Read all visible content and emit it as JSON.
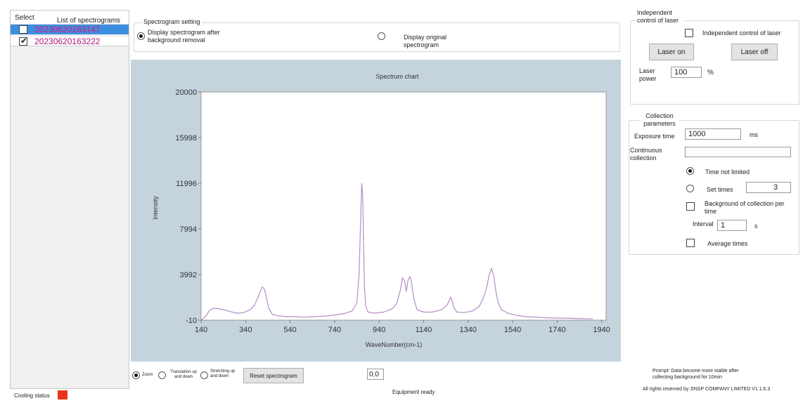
{
  "spectrogram_list": {
    "select_header": "Select",
    "list_header": "List of spectrograms",
    "items": [
      {
        "name": "20230620163147",
        "checked": false,
        "selected": true
      },
      {
        "name": "20230620163222",
        "checked": true,
        "selected": false
      }
    ]
  },
  "spectrogram_setting": {
    "title": "Spectrogram setting",
    "option_bg_removal": "Display spectrogram after background removal",
    "option_original": "Display original spectrogram",
    "selected": "bg_removal"
  },
  "chart_data": {
    "type": "line",
    "title": "Spectrum chart",
    "xlabel": "WaveNumber(cm-1)",
    "ylabel": "Intensity",
    "xlim": [
      140,
      1960
    ],
    "ylim": [
      -10,
      20000
    ],
    "xticks": [
      140,
      340,
      540,
      740,
      940,
      1140,
      1340,
      1540,
      1740,
      1940
    ],
    "yticks": [
      -10,
      3992,
      7994,
      11996,
      15998,
      20000
    ],
    "grid": false,
    "series": [
      {
        "color": "#b48cc8",
        "x": [
          140,
          160,
          180,
          200,
          230,
          260,
          300,
          330,
          360,
          380,
          400,
          415,
          425,
          435,
          445,
          460,
          480,
          520,
          560,
          600,
          650,
          700,
          740,
          780,
          820,
          840,
          850,
          858,
          862,
          866,
          870,
          874,
          880,
          890,
          920,
          960,
          1000,
          1020,
          1035,
          1045,
          1055,
          1062,
          1070,
          1078,
          1085,
          1095,
          1110,
          1140,
          1180,
          1220,
          1245,
          1262,
          1268,
          1275,
          1290,
          1320,
          1360,
          1390,
          1410,
          1425,
          1435,
          1445,
          1455,
          1465,
          1475,
          1490,
          1520,
          1560,
          1600,
          1700,
          1800,
          1900
        ],
        "y": [
          0,
          300,
          900,
          1050,
          950,
          800,
          600,
          650,
          900,
          1300,
          2200,
          2900,
          2700,
          1800,
          1000,
          500,
          400,
          300,
          300,
          250,
          300,
          350,
          450,
          550,
          800,
          1500,
          4000,
          9500,
          12000,
          11000,
          7000,
          3000,
          1200,
          700,
          600,
          700,
          1000,
          1500,
          2600,
          3700,
          3400,
          2500,
          3500,
          3800,
          3400,
          2000,
          900,
          700,
          700,
          900,
          1300,
          2000,
          1700,
          1100,
          700,
          650,
          800,
          1200,
          2000,
          3000,
          4000,
          4500,
          3900,
          2500,
          1500,
          900,
          600,
          400,
          300,
          200,
          150,
          100
        ]
      }
    ]
  },
  "chart_controls": {
    "zoom": "Zoom",
    "translation": "Translation up and down",
    "stretching": "Stretching up and down",
    "selected_mode": "zoom",
    "reset_label": "Reset spectrogram",
    "coords": "0,0"
  },
  "status": {
    "equipment": "Equipment ready",
    "cooling_label": "Cooling status",
    "cooling_color": "#e8341c",
    "prompt": "Prompt: Data become more stable after collecting background for 10min",
    "copyright": "All rights reserved by JINSP COMPANY LIMITED V1.1.6.3"
  },
  "laser": {
    "title": "Independent control of laser",
    "checkbox_label": "Independent control of laser",
    "checked": false,
    "on_label": "Laser on",
    "off_label": "Laser off",
    "power_label": "Laser power",
    "power_value": "100",
    "power_unit": "%"
  },
  "collection": {
    "title": "Collection parameters",
    "exposure_label": "Exposure time",
    "exposure_value": "1000",
    "exposure_unit": "ms",
    "continuous_label": "Continuous collection",
    "continuous_value": "",
    "time_not_limited": "Time not limited",
    "set_times": "Set times",
    "set_times_value": "3",
    "mode": "time_not_limited",
    "bg_per_time": "Background of collection per time",
    "bg_checked": false,
    "interval_label": "Interval",
    "interval_value": "1",
    "interval_unit": "s",
    "average_times": "Average times",
    "average_checked": false
  },
  "colors": {
    "selected_row": "#3c8fe0",
    "selected_row_text": "#e0177f",
    "row_text": "#b0127a",
    "chart_bg": "#c5d3dd",
    "line": "#b48cc8"
  }
}
